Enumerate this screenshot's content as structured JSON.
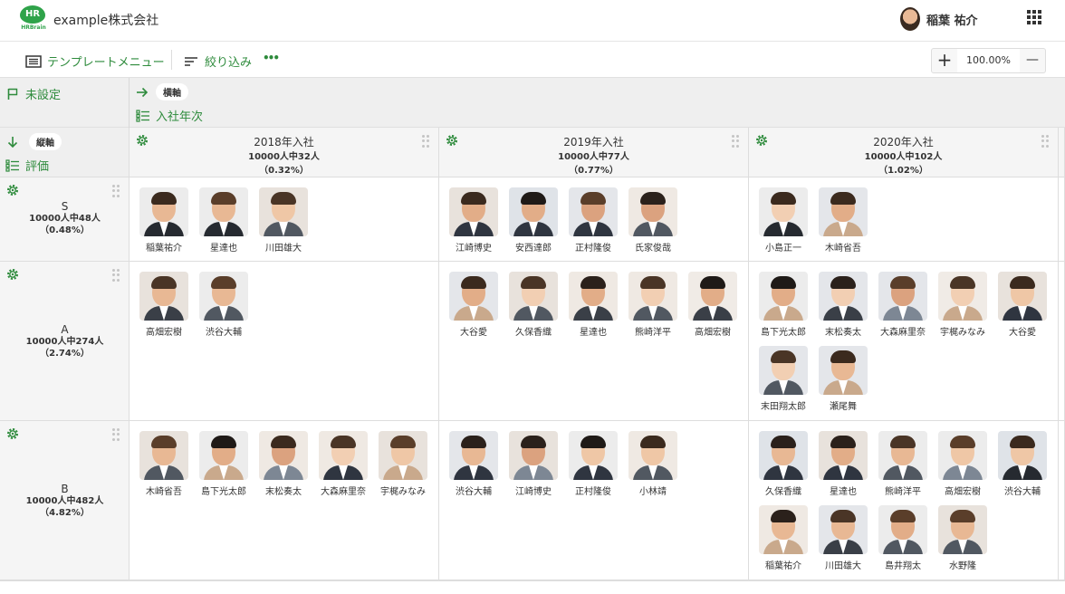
{
  "app": {
    "logo_text": "HR",
    "logo_sub": "HRBrain",
    "company": "example株式会社",
    "user_name": "稲葉 祐介"
  },
  "toolbar": {
    "template_menu": "テンプレートメニュー",
    "filter": "絞り込み",
    "more": "•••",
    "zoom_in": "+",
    "zoom_value": "100.00%",
    "zoom_out": "—"
  },
  "axes": {
    "unset_label": "未設定",
    "horizontal_pill": "横軸",
    "horizontal_field": "入社年次",
    "vertical_pill": "縦軸",
    "vertical_field": "評価"
  },
  "columns": [
    {
      "title": "2018年入社",
      "count": "10000人中32人",
      "pct": "（0.32%）"
    },
    {
      "title": "2019年入社",
      "count": "10000人中77人",
      "pct": "（0.77%）"
    },
    {
      "title": "2020年入社",
      "count": "10000人中102人",
      "pct": "（1.02%）"
    }
  ],
  "rows": [
    {
      "grade": "S",
      "count": "10000人中48人",
      "pct": "（0.48%）"
    },
    {
      "grade": "A",
      "count": "10000人中274人",
      "pct": "（2.74%）"
    },
    {
      "grade": "B",
      "count": "10000人中482人",
      "pct": "（4.82%）"
    }
  ],
  "cells": [
    [
      [
        "稲葉祐介",
        "星達也",
        "川田雄大"
      ],
      [
        "江崎博史",
        "安西達郎",
        "正村隆俊",
        "氏家俊哉"
      ],
      [
        "小島正一",
        "木崎省吾"
      ]
    ],
    [
      [
        "高畑宏樹",
        "渋谷大輔"
      ],
      [
        "大谷愛",
        "久保香織",
        "星達也",
        "熊崎洋平",
        "高畑宏樹"
      ],
      [
        "島下光太郎",
        "末松奏太",
        "大森麻里奈",
        "宇梶みなみ",
        "大谷愛",
        "末田翔太郎",
        "瀬尾舞"
      ]
    ],
    [
      [
        "木崎省吾",
        "島下光太郎",
        "末松奏太",
        "大森麻里奈",
        "宇梶みなみ"
      ],
      [
        "渋谷大輔",
        "江崎博史",
        "正村隆俊",
        "小林靖"
      ],
      [
        "久保香織",
        "星達也",
        "熊崎洋平",
        "高畑宏樹",
        "渋谷大輔",
        "稲葉祐介",
        "川田雄大",
        "島井翔太",
        "水野隆"
      ]
    ]
  ],
  "colors": {
    "accent": "#2e8b3c",
    "grid_line": "#dddddd",
    "header_bg": "#f5f5f5",
    "axis_bg": "#efefef"
  }
}
